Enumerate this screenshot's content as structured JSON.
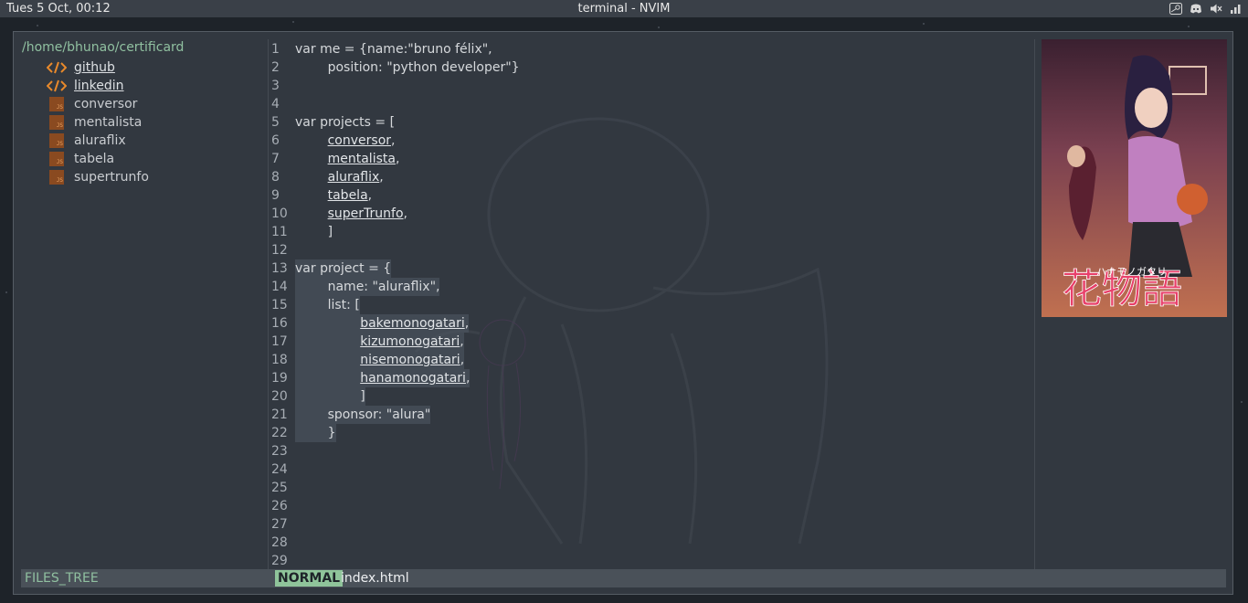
{
  "topbar": {
    "clock": "Tues 5 Oct, 00:12",
    "title": "terminal - NVIM",
    "tray_icons": [
      "steam-icon",
      "discord-icon",
      "volume-muted-icon",
      "battery-icon"
    ]
  },
  "filetree": {
    "path": "/home/bhunao/certificard",
    "items": [
      {
        "label": "github",
        "icon": "code-icon"
      },
      {
        "label": "linkedin",
        "icon": "code-icon"
      },
      {
        "label": "conversor",
        "icon": "js-file-icon"
      },
      {
        "label": "mentalista",
        "icon": "js-file-icon"
      },
      {
        "label": "aluraflix",
        "icon": "js-file-icon"
      },
      {
        "label": "tabela",
        "icon": "js-file-icon"
      },
      {
        "label": "supertrunfo",
        "icon": "js-file-icon"
      }
    ],
    "js_icon_text": "JS"
  },
  "editor": {
    "lines": [
      {
        "n": "1",
        "parts": [
          {
            "t": "var me = {name:\"bruno félix\","
          }
        ]
      },
      {
        "n": "2",
        "parts": [
          {
            "t": "        position: \"python developer\"}"
          }
        ]
      },
      {
        "n": "3",
        "parts": []
      },
      {
        "n": "4",
        "parts": []
      },
      {
        "n": "5",
        "parts": [
          {
            "t": "var projects = ["
          }
        ]
      },
      {
        "n": "6",
        "parts": [
          {
            "t": "        "
          },
          {
            "t": "conversor",
            "u": true
          },
          {
            "t": ","
          }
        ]
      },
      {
        "n": "7",
        "parts": [
          {
            "t": "        "
          },
          {
            "t": "mentalista",
            "u": true
          },
          {
            "t": ","
          }
        ]
      },
      {
        "n": "8",
        "parts": [
          {
            "t": "        "
          },
          {
            "t": "aluraflix",
            "u": true
          },
          {
            "t": ","
          }
        ]
      },
      {
        "n": "9",
        "parts": [
          {
            "t": "        "
          },
          {
            "t": "tabela",
            "u": true
          },
          {
            "t": ","
          }
        ]
      },
      {
        "n": "10",
        "parts": [
          {
            "t": "        "
          },
          {
            "t": "superTrunfo",
            "u": true
          },
          {
            "t": ","
          }
        ]
      },
      {
        "n": "11",
        "parts": [
          {
            "t": "        ]"
          }
        ]
      },
      {
        "n": "12",
        "parts": []
      },
      {
        "n": "13",
        "parts": [
          {
            "t": "var project = {"
          }
        ]
      },
      {
        "n": "14",
        "parts": [
          {
            "t": "        name: \"aluraflix\","
          }
        ]
      },
      {
        "n": "15",
        "parts": [
          {
            "t": "        list: ["
          }
        ]
      },
      {
        "n": "16",
        "parts": [
          {
            "t": "                "
          },
          {
            "t": "bakemonogatari",
            "u": true
          },
          {
            "t": ","
          }
        ]
      },
      {
        "n": "17",
        "parts": [
          {
            "t": "                "
          },
          {
            "t": "kizumonogatari",
            "u": true
          },
          {
            "t": ","
          }
        ]
      },
      {
        "n": "18",
        "parts": [
          {
            "t": "                "
          },
          {
            "t": "nisemonogatari",
            "u": true
          },
          {
            "t": ","
          }
        ]
      },
      {
        "n": "19",
        "parts": [
          {
            "t": "                "
          },
          {
            "t": "hanamonogatari",
            "u": true
          },
          {
            "t": ","
          }
        ]
      },
      {
        "n": "20",
        "parts": [
          {
            "t": "                ]"
          }
        ]
      },
      {
        "n": "21",
        "parts": [
          {
            "t": "        sponsor: \"alura\""
          }
        ]
      },
      {
        "n": "22",
        "parts": [
          {
            "t": "        }"
          }
        ]
      },
      {
        "n": "23",
        "parts": []
      },
      {
        "n": "24",
        "parts": []
      },
      {
        "n": "25",
        "parts": []
      },
      {
        "n": "26",
        "parts": []
      },
      {
        "n": "27",
        "parts": []
      },
      {
        "n": "28",
        "parts": []
      },
      {
        "n": "29",
        "parts": []
      }
    ],
    "highlight_lines": [
      "13",
      "14",
      "15",
      "16",
      "17",
      "18",
      "19",
      "20",
      "21",
      "22"
    ]
  },
  "poster": {
    "title_text": "花物語",
    "subtitle_text": "ハナモノガタリ"
  },
  "statusbar": {
    "left_label": "FILES_TREE",
    "mode": "NORMAL",
    "filename": "index.html"
  },
  "colors": {
    "accent_green": "#8fc49a",
    "window_bg": "#323840",
    "topbar_bg": "#3a4048",
    "code_icon_orange": "#e8892b"
  }
}
